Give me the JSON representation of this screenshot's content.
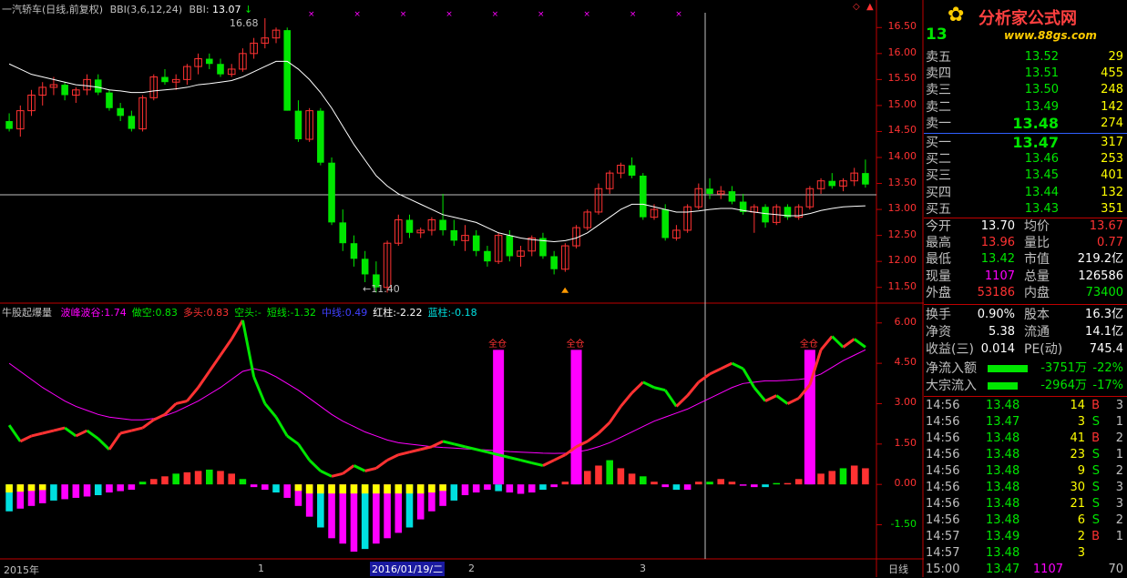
{
  "colors": {
    "up": "#ff3232",
    "down": "#00e600",
    "ma": "#ffffff",
    "fuchsia": "#ff00ff",
    "cyan": "#00e0e0",
    "yellow": "#ffff00",
    "axis": "#c00000",
    "label": "#c0c0c0"
  },
  "header": {
    "stock": "一汽轿车(日线,前复权)",
    "bbi_params": "BBI(3,6,12,24)",
    "bbi_label": "BBI:",
    "bbi_value": "13.07",
    "marks": "× × × × × × × × ×"
  },
  "price_panel": {
    "high_label": "16.68",
    "low_label": "←11.40",
    "yticks": [
      "16.50",
      "16.00",
      "15.50",
      "15.00",
      "14.50",
      "14.00",
      "13.50",
      "13.00",
      "12.50",
      "12.00",
      "11.50"
    ]
  },
  "indicator": {
    "name": "牛股起爆量",
    "items": [
      {
        "label": "波峰波谷:",
        "value": "1.74",
        "color": "#ff00ff"
      },
      {
        "label": "做空:",
        "value": "0.83",
        "color": "#00e600"
      },
      {
        "label": "多头:",
        "value": "0.83",
        "color": "#ff3232"
      },
      {
        "label": "空头:",
        "value": "-",
        "color": "#00e600"
      },
      {
        "label": "短线:",
        "value": "-1.32",
        "color": "#00e600"
      },
      {
        "label": "中线:",
        "value": "0.49",
        "color": "#4040ff"
      },
      {
        "label": "红柱:",
        "value": "-2.22",
        "color": "#ffffff"
      },
      {
        "label": "蓝柱:",
        "value": "-0.18",
        "color": "#00e0e0"
      }
    ],
    "full_position_label": "全仓",
    "yticks": [
      "6.00",
      "4.50",
      "3.00",
      "1.50",
      "0.00",
      "-1.50"
    ]
  },
  "timeline": {
    "year": "2015年",
    "m1": "1",
    "date": "2016/01/19/二",
    "m2": "2",
    "m3": "3",
    "period": "日线"
  },
  "logo": {
    "title": "分析家公式网",
    "url": "www.88gs.com"
  },
  "quote": {
    "price": "13",
    "sell": [
      {
        "label": "卖五",
        "price": "13.52",
        "vol": "29"
      },
      {
        "label": "卖四",
        "price": "13.51",
        "vol": "455"
      },
      {
        "label": "卖三",
        "price": "13.50",
        "vol": "248"
      },
      {
        "label": "卖二",
        "price": "13.49",
        "vol": "142"
      },
      {
        "label": "卖一",
        "price": "13.48",
        "vol": "274"
      }
    ],
    "buy": [
      {
        "label": "买一",
        "price": "13.47",
        "vol": "317"
      },
      {
        "label": "买二",
        "price": "13.46",
        "vol": "253"
      },
      {
        "label": "买三",
        "price": "13.45",
        "vol": "401"
      },
      {
        "label": "买四",
        "price": "13.44",
        "vol": "132"
      },
      {
        "label": "买五",
        "price": "13.43",
        "vol": "351"
      }
    ],
    "stats": [
      [
        "今开",
        "13.70",
        "均价",
        "13.67"
      ],
      [
        "最高",
        "13.96",
        "量比",
        "0.77"
      ],
      [
        "最低",
        "13.42",
        "市值",
        "219.2亿"
      ],
      [
        "现量",
        "1107",
        "总量",
        "126586"
      ],
      [
        "外盘",
        "53186",
        "内盘",
        "73400"
      ]
    ],
    "fin": [
      [
        "换手",
        "0.90%",
        "股本",
        "16.3亿"
      ],
      [
        "净资",
        "5.38",
        "流通",
        "14.1亿"
      ],
      [
        "收益(三)",
        "0.014",
        "PE(动)",
        "745.4"
      ]
    ],
    "flows": [
      {
        "label": "净流入额",
        "amount": "-3751万",
        "pct": "-22%"
      },
      {
        "label": "大宗流入",
        "amount": "-2964万",
        "pct": "-17%"
      }
    ],
    "ticks": [
      [
        "14:56",
        "13.48",
        "14",
        "B",
        "3"
      ],
      [
        "14:56",
        "13.47",
        "3",
        "S",
        "1"
      ],
      [
        "14:56",
        "13.48",
        "41",
        "B",
        "2"
      ],
      [
        "14:56",
        "13.48",
        "23",
        "S",
        "1"
      ],
      [
        "14:56",
        "13.48",
        "9",
        "S",
        "2"
      ],
      [
        "14:56",
        "13.48",
        "30",
        "S",
        "3"
      ],
      [
        "14:56",
        "13.48",
        "21",
        "S",
        "3"
      ],
      [
        "14:56",
        "13.48",
        "6",
        "S",
        "2"
      ],
      [
        "14:57",
        "13.49",
        "2",
        "B",
        "1"
      ],
      [
        "14:57",
        "13.48",
        "3",
        "",
        ""
      ],
      [
        "15:00",
        "13.47",
        "1107",
        "",
        "70"
      ]
    ]
  },
  "chart_data": {
    "type": "candlestick",
    "candles": [
      [
        14.7,
        14.85,
        14.5,
        14.55
      ],
      [
        14.55,
        15.0,
        14.4,
        14.9
      ],
      [
        14.9,
        15.3,
        14.8,
        15.2
      ],
      [
        15.2,
        15.45,
        15.0,
        15.35
      ],
      [
        15.35,
        15.55,
        15.2,
        15.4
      ],
      [
        15.4,
        15.45,
        15.1,
        15.2
      ],
      [
        15.2,
        15.35,
        15.05,
        15.3
      ],
      [
        15.3,
        15.6,
        15.2,
        15.5
      ],
      [
        15.5,
        15.6,
        15.2,
        15.25
      ],
      [
        15.25,
        15.3,
        14.9,
        14.95
      ],
      [
        14.95,
        15.05,
        14.7,
        14.8
      ],
      [
        14.8,
        14.9,
        14.5,
        14.55
      ],
      [
        14.55,
        15.2,
        14.5,
        15.15
      ],
      [
        15.15,
        15.6,
        15.1,
        15.55
      ],
      [
        15.55,
        15.7,
        15.4,
        15.45
      ],
      [
        15.45,
        15.6,
        15.3,
        15.5
      ],
      [
        15.5,
        15.8,
        15.4,
        15.75
      ],
      [
        15.75,
        16.0,
        15.6,
        15.9
      ],
      [
        15.9,
        16.0,
        15.7,
        15.8
      ],
      [
        15.8,
        15.9,
        15.55,
        15.6
      ],
      [
        15.6,
        15.8,
        15.55,
        15.7
      ],
      [
        15.7,
        16.1,
        15.65,
        16.0
      ],
      [
        16.0,
        16.3,
        15.9,
        16.2
      ],
      [
        16.2,
        16.68,
        16.1,
        16.3
      ],
      [
        16.3,
        16.5,
        16.2,
        16.45
      ],
      [
        16.45,
        16.5,
        14.9,
        14.9
      ],
      [
        14.9,
        15.1,
        14.3,
        14.35
      ],
      [
        14.35,
        14.95,
        14.3,
        14.9
      ],
      [
        14.9,
        14.95,
        13.85,
        13.9
      ],
      [
        13.9,
        14.0,
        12.7,
        12.75
      ],
      [
        12.75,
        13.0,
        12.2,
        12.35
      ],
      [
        12.35,
        12.5,
        11.9,
        12.05
      ],
      [
        12.05,
        12.2,
        11.6,
        11.75
      ],
      [
        11.75,
        12.0,
        11.4,
        11.5
      ],
      [
        11.5,
        12.4,
        11.4,
        12.35
      ],
      [
        12.35,
        12.9,
        12.3,
        12.8
      ],
      [
        12.8,
        12.9,
        12.45,
        12.55
      ],
      [
        12.55,
        12.65,
        12.45,
        12.6
      ],
      [
        12.6,
        12.85,
        12.5,
        12.8
      ],
      [
        12.8,
        13.3,
        12.5,
        12.6
      ],
      [
        12.6,
        12.8,
        12.3,
        12.4
      ],
      [
        12.4,
        12.7,
        12.2,
        12.5
      ],
      [
        12.5,
        12.6,
        12.1,
        12.2
      ],
      [
        12.2,
        12.3,
        11.9,
        12.0
      ],
      [
        12.0,
        12.55,
        11.95,
        12.5
      ],
      [
        12.5,
        12.6,
        12.0,
        12.1
      ],
      [
        12.1,
        12.3,
        11.9,
        12.2
      ],
      [
        12.2,
        12.5,
        12.1,
        12.45
      ],
      [
        12.45,
        12.55,
        12.05,
        12.1
      ],
      [
        12.1,
        12.2,
        11.75,
        11.85
      ],
      [
        11.85,
        12.35,
        11.8,
        12.3
      ],
      [
        12.3,
        12.7,
        12.25,
        12.65
      ],
      [
        12.65,
        13.0,
        12.6,
        12.95
      ],
      [
        12.95,
        13.5,
        12.9,
        13.4
      ],
      [
        13.4,
        13.75,
        13.3,
        13.7
      ],
      [
        13.7,
        13.9,
        13.6,
        13.85
      ],
      [
        13.85,
        14.0,
        13.6,
        13.65
      ],
      [
        13.65,
        13.7,
        12.8,
        12.85
      ],
      [
        12.85,
        13.1,
        12.8,
        13.0
      ],
      [
        13.0,
        13.1,
        12.4,
        12.45
      ],
      [
        12.45,
        12.7,
        12.4,
        12.6
      ],
      [
        12.6,
        13.1,
        12.55,
        13.05
      ],
      [
        13.05,
        13.5,
        13.0,
        13.4
      ],
      [
        13.4,
        13.6,
        13.2,
        13.3
      ],
      [
        13.3,
        13.45,
        13.2,
        13.35
      ],
      [
        13.35,
        13.45,
        13.1,
        13.15
      ],
      [
        13.15,
        13.3,
        12.9,
        12.95
      ],
      [
        12.95,
        13.1,
        12.55,
        13.05
      ],
      [
        13.05,
        13.1,
        12.65,
        12.75
      ],
      [
        12.75,
        13.1,
        12.7,
        13.05
      ],
      [
        13.05,
        13.1,
        12.8,
        12.85
      ],
      [
        12.85,
        13.1,
        12.8,
        13.05
      ],
      [
        13.05,
        13.45,
        13.0,
        13.4
      ],
      [
        13.4,
        13.6,
        13.3,
        13.55
      ],
      [
        13.55,
        13.7,
        13.4,
        13.45
      ],
      [
        13.45,
        13.6,
        13.35,
        13.55
      ],
      [
        13.55,
        13.8,
        13.45,
        13.7
      ],
      [
        13.7,
        13.96,
        13.42,
        13.48
      ]
    ],
    "bbi": [
      15.8,
      15.7,
      15.6,
      15.55,
      15.5,
      15.45,
      15.4,
      15.38,
      15.35,
      15.3,
      15.28,
      15.25,
      15.25,
      15.28,
      15.3,
      15.32,
      15.35,
      15.4,
      15.42,
      15.45,
      15.48,
      15.55,
      15.65,
      15.75,
      15.85,
      15.85,
      15.7,
      15.5,
      15.25,
      14.95,
      14.6,
      14.25,
      13.95,
      13.65,
      13.45,
      13.3,
      13.2,
      13.1,
      13.0,
      12.9,
      12.85,
      12.8,
      12.75,
      12.65,
      12.55,
      12.5,
      12.45,
      12.42,
      12.4,
      12.38,
      12.4,
      12.45,
      12.55,
      12.7,
      12.85,
      13.0,
      13.1,
      13.1,
      13.05,
      13.0,
      12.95,
      12.95,
      12.97,
      13.0,
      13.02,
      13.02,
      12.98,
      12.95,
      12.92,
      12.9,
      12.88,
      12.88,
      12.92,
      12.98,
      13.02,
      13.05,
      13.06,
      13.07
    ],
    "indicator_line": [
      2.2,
      1.6,
      1.8,
      1.9,
      2.0,
      2.1,
      1.8,
      2.0,
      1.7,
      1.3,
      1.9,
      2.0,
      2.1,
      2.4,
      2.6,
      3.0,
      3.1,
      3.6,
      4.2,
      4.8,
      5.4,
      6.1,
      4.0,
      3.0,
      2.5,
      1.8,
      1.5,
      0.9,
      0.5,
      0.3,
      0.4,
      0.7,
      0.5,
      0.6,
      0.9,
      1.1,
      1.2,
      1.3,
      1.4,
      1.6,
      1.5,
      1.4,
      1.3,
      1.2,
      1.1,
      1.0,
      0.9,
      0.8,
      0.7,
      0.9,
      1.1,
      1.4,
      1.6,
      1.9,
      2.3,
      2.9,
      3.4,
      3.8,
      3.6,
      3.5,
      2.9,
      3.3,
      3.8,
      4.1,
      4.3,
      4.5,
      4.3,
      3.6,
      3.1,
      3.3,
      3.0,
      3.2,
      3.7,
      5.0,
      5.5,
      5.1,
      5.4,
      5.1
    ],
    "indicator_ma": [
      4.5,
      4.2,
      3.9,
      3.6,
      3.35,
      3.1,
      2.9,
      2.75,
      2.6,
      2.5,
      2.45,
      2.4,
      2.4,
      2.45,
      2.55,
      2.7,
      2.9,
      3.1,
      3.35,
      3.6,
      3.9,
      4.2,
      4.3,
      4.2,
      4.0,
      3.75,
      3.5,
      3.2,
      2.9,
      2.6,
      2.35,
      2.15,
      1.95,
      1.8,
      1.65,
      1.55,
      1.5,
      1.45,
      1.4,
      1.37,
      1.35,
      1.32,
      1.3,
      1.28,
      1.25,
      1.22,
      1.2,
      1.18,
      1.16,
      1.15,
      1.16,
      1.2,
      1.28,
      1.4,
      1.55,
      1.75,
      1.95,
      2.15,
      2.35,
      2.5,
      2.65,
      2.8,
      3.0,
      3.2,
      3.4,
      3.6,
      3.75,
      3.8,
      3.85,
      3.85,
      3.87,
      3.9,
      3.95,
      4.1,
      4.35,
      4.6,
      4.8,
      5.0
    ],
    "bars": [
      -1.0,
      -0.9,
      -0.8,
      -0.7,
      -0.6,
      -0.55,
      -0.5,
      -0.45,
      -0.4,
      -0.3,
      -0.25,
      -0.2,
      0.1,
      0.2,
      0.3,
      0.4,
      0.45,
      0.5,
      0.55,
      0.5,
      0.4,
      0.2,
      -0.1,
      -0.2,
      -0.3,
      -0.5,
      -0.8,
      -1.2,
      -1.6,
      -2.0,
      -2.2,
      -2.5,
      -2.4,
      -2.2,
      -2.0,
      -1.8,
      -1.6,
      -1.3,
      -1.0,
      -0.8,
      -0.6,
      -0.4,
      -0.3,
      -0.2,
      -0.25,
      -0.3,
      -0.35,
      -0.3,
      -0.2,
      -0.1,
      0.1,
      0.3,
      0.5,
      0.7,
      0.9,
      0.6,
      0.4,
      0.3,
      0.1,
      -0.1,
      -0.2,
      -0.2,
      0.1,
      0.1,
      0.2,
      0.1,
      -0.05,
      -0.1,
      -0.1,
      0.05,
      0.05,
      0.2,
      0.3,
      0.4,
      0.5,
      0.6,
      0.7,
      0.6
    ],
    "full_position_bars": [
      [
        44,
        5.0
      ],
      [
        51,
        5.0
      ],
      [
        72,
        5.0
      ]
    ],
    "price_range": [
      11.25,
      16.75
    ],
    "indicator_range": [
      -2.7,
      6.5
    ]
  }
}
